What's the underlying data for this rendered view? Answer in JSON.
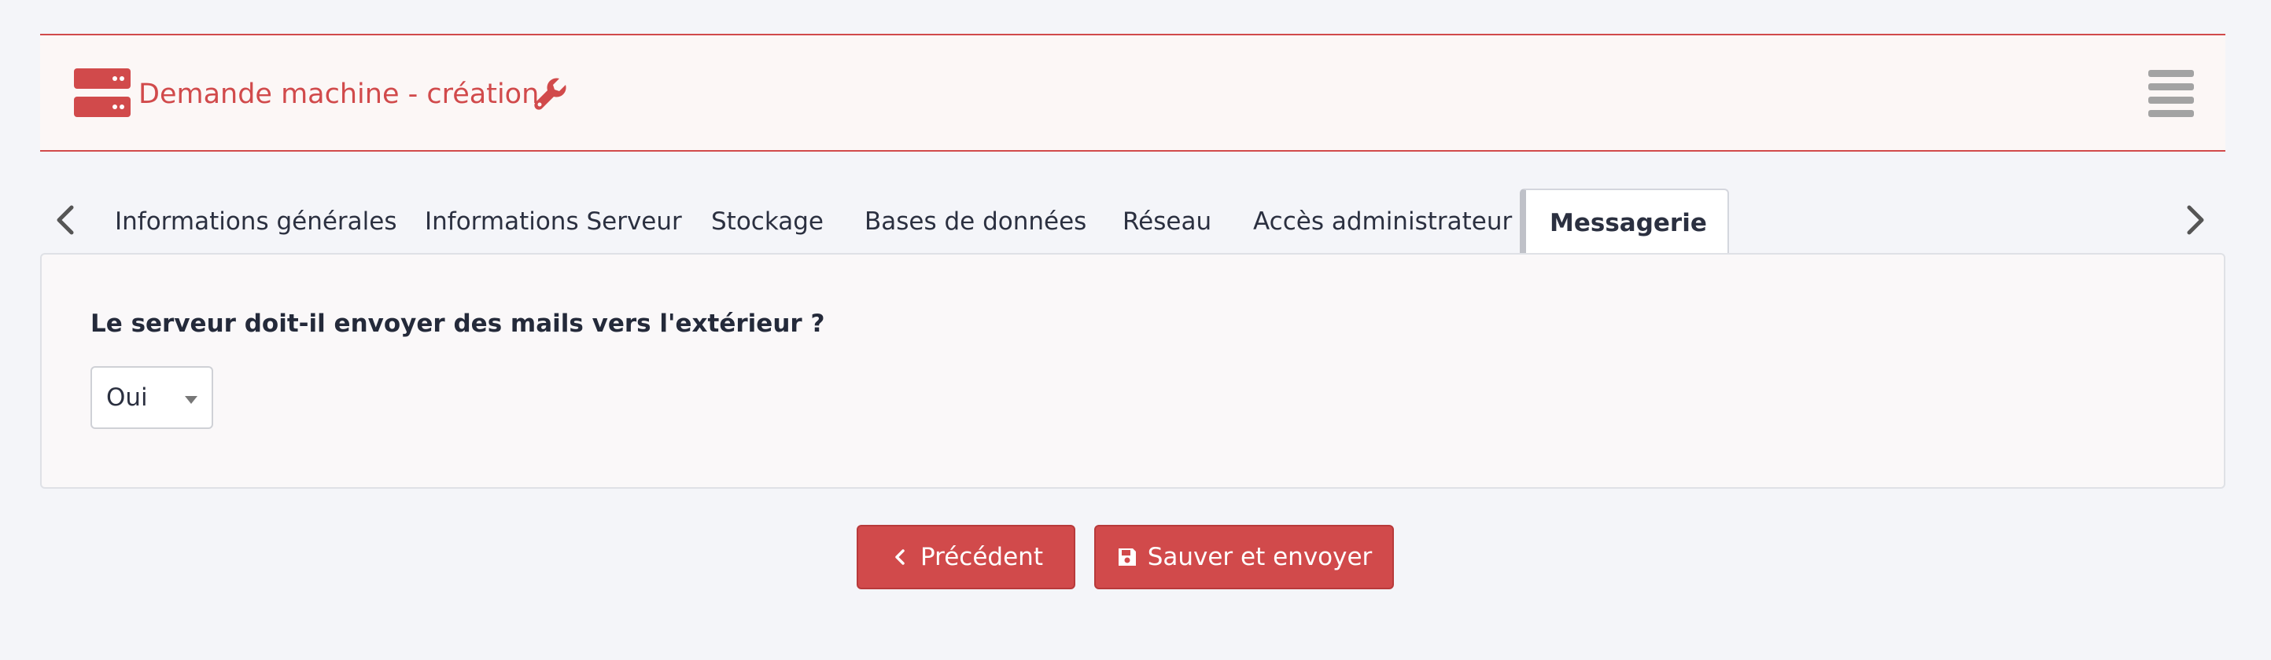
{
  "header": {
    "title": "Demande machine - création",
    "icons": {
      "left": "server-icon",
      "right": "wrench-icon",
      "menu": "hamburger-icon"
    },
    "accent_color": "#d14a4b"
  },
  "tabs": {
    "items": [
      {
        "label": "Informations générales",
        "active": false
      },
      {
        "label": "Informations Serveur",
        "active": false
      },
      {
        "label": "Stockage",
        "active": false
      },
      {
        "label": "Bases de données",
        "active": false
      },
      {
        "label": "Réseau",
        "active": false
      },
      {
        "label": "Accès administrateur",
        "active": false
      },
      {
        "label": "Messagerie",
        "active": true
      }
    ]
  },
  "form": {
    "question": "Le serveur doit-il envoyer des mails vers l'extérieur ?",
    "select": {
      "value": "Oui"
    }
  },
  "buttons": {
    "previous": "Précédent",
    "save": "Sauver et envoyer"
  }
}
